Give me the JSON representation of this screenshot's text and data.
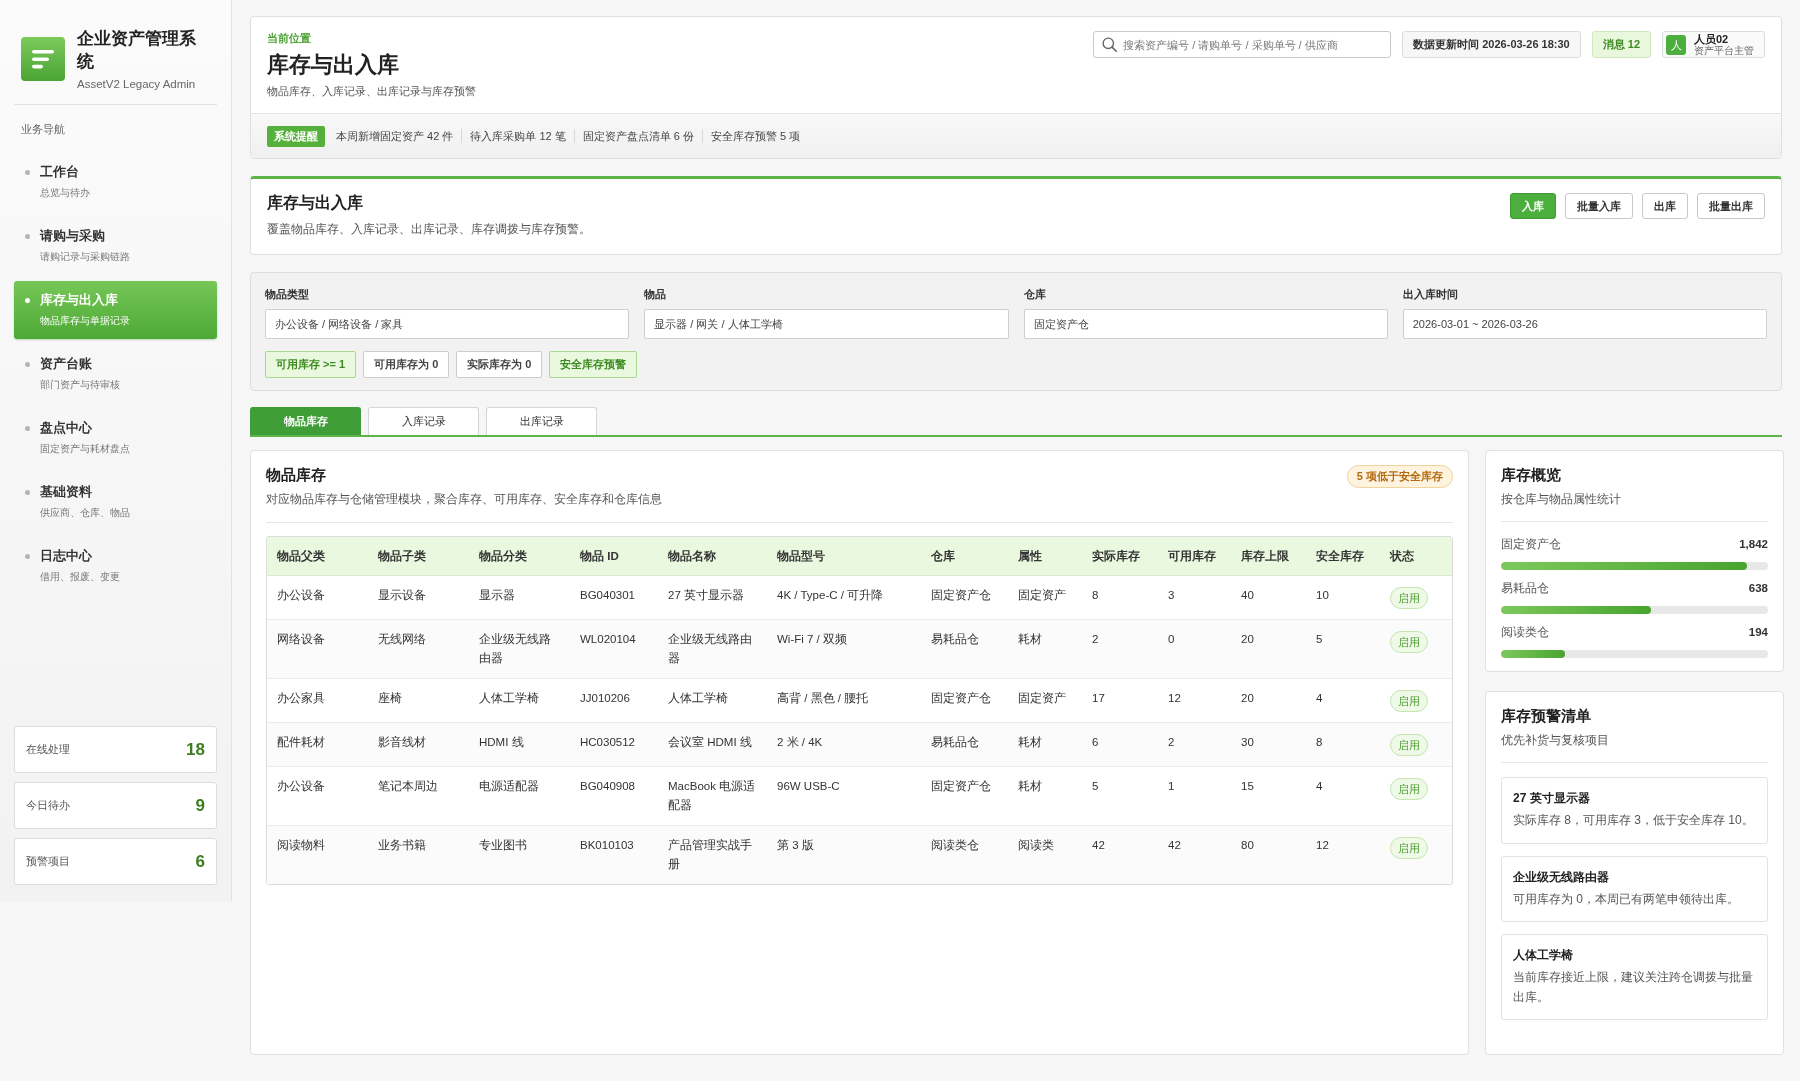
{
  "sidebar": {
    "app_title": "企业资产管理系统",
    "app_subtitle": "AssetV2 Legacy Admin",
    "section_label": "业务导航",
    "items": [
      {
        "title": "工作台",
        "subtitle": "总览与待办",
        "selected": false
      },
      {
        "title": "请购与采购",
        "subtitle": "请购记录与采购链路",
        "selected": false
      },
      {
        "title": "库存与出入库",
        "subtitle": "物品库存与单据记录",
        "selected": true
      },
      {
        "title": "资产台账",
        "subtitle": "部门资产与待审核",
        "selected": false
      },
      {
        "title": "盘点中心",
        "subtitle": "固定资产与耗材盘点",
        "selected": false
      },
      {
        "title": "基础资料",
        "subtitle": "供应商、仓库、物品",
        "selected": false
      },
      {
        "title": "日志中心",
        "subtitle": "借用、报废、变更",
        "selected": false
      }
    ],
    "stats": [
      {
        "label": "在线处理",
        "value": "18"
      },
      {
        "label": "今日待办",
        "value": "9"
      },
      {
        "label": "预警项目",
        "value": "6"
      }
    ]
  },
  "header": {
    "breadcrumb": "当前位置",
    "title": "库存与出入库",
    "subtitle": "物品库存、入库记录、出库记录与库存预警",
    "search": {
      "placeholder": "搜索资产编号 / 请购单号 / 采购单号 / 供应商"
    },
    "updated": "数据更新时间 2026-03-26 18:30",
    "messages": "消息 12",
    "user": {
      "avatar": "人",
      "name": "人员02",
      "role": "资产平台主管"
    }
  },
  "notice_bar": {
    "tag": "系统提醒",
    "items": [
      "本周新增固定资产 42 件",
      "待入库采购单 12 笔",
      "固定资产盘点清单 6 份",
      "安全库存预警 5 项"
    ]
  },
  "section": {
    "title": "库存与出入库",
    "subtitle": "覆盖物品库存、入库记录、出库记录、库存调拨与库存预警。",
    "buttons": [
      {
        "label": "入库",
        "kind": "primary"
      },
      {
        "label": "批量入库",
        "kind": "secondary"
      },
      {
        "label": "出库",
        "kind": "secondary"
      },
      {
        "label": "批量出库",
        "kind": "secondary"
      }
    ]
  },
  "filters": {
    "fields": [
      {
        "label": "物品类型",
        "value": "办公设备 / 网络设备 / 家具"
      },
      {
        "label": "物品",
        "value": "显示器 / 网关 / 人体工学椅"
      },
      {
        "label": "仓库",
        "value": "固定资产仓"
      },
      {
        "label": "出入库时间",
        "value": "2026-03-01 ~ 2026-03-26"
      }
    ],
    "chips": [
      {
        "label": "可用库存 >= 1",
        "selected": true
      },
      {
        "label": "可用库存为 0",
        "selected": false
      },
      {
        "label": "实际库存为 0",
        "selected": false
      },
      {
        "label": "安全库存预警",
        "selected": true
      }
    ]
  },
  "tabs": [
    {
      "label": "物品库存",
      "selected": true
    },
    {
      "label": "入库记录",
      "selected": false
    },
    {
      "label": "出库记录",
      "selected": false
    }
  ],
  "inventory": {
    "title": "物品库存",
    "subtitle": "对应物品库存与仓储管理模块，聚合库存、可用库存、安全库存和仓库信息",
    "badge": "5 项低于安全库存",
    "table": {
      "columns": [
        "物品父类",
        "物品子类",
        "物品分类",
        "物品 ID",
        "物品名称",
        "物品型号",
        "仓库",
        "属性",
        "实际库存",
        "可用库存",
        "库存上限",
        "安全库存",
        "状态"
      ],
      "rows": [
        {
          "cells": [
            "办公设备",
            "显示设备",
            "显示器",
            "BG040301",
            "27 英寸显示器",
            "4K / Type-C / 可升降",
            "固定资产仓",
            "固定资产",
            "8",
            "3",
            "40",
            "10"
          ],
          "status": "启用"
        },
        {
          "cells": [
            "网络设备",
            "无线网络",
            "企业级无线路由器",
            "WL020104",
            "企业级无线路由器",
            "Wi-Fi 7 / 双频",
            "易耗品仓",
            "耗材",
            "2",
            "0",
            "20",
            "5"
          ],
          "status": "启用"
        },
        {
          "cells": [
            "办公家具",
            "座椅",
            "人体工学椅",
            "JJ010206",
            "人体工学椅",
            "高背 / 黑色 / 腰托",
            "固定资产仓",
            "固定资产",
            "17",
            "12",
            "20",
            "4"
          ],
          "status": "启用"
        },
        {
          "cells": [
            "配件耗材",
            "影音线材",
            "HDMI 线",
            "HC030512",
            "会议室 HDMI 线",
            "2 米 / 4K",
            "易耗品仓",
            "耗材",
            "6",
            "2",
            "30",
            "8"
          ],
          "status": "启用"
        },
        {
          "cells": [
            "办公设备",
            "笔记本周边",
            "电源适配器",
            "BG040908",
            "MacBook 电源适配器",
            "96W USB-C",
            "固定资产仓",
            "耗材",
            "5",
            "1",
            "15",
            "4"
          ],
          "status": "启用"
        },
        {
          "cells": [
            "阅读物料",
            "业务书籍",
            "专业图书",
            "BK010103",
            "产品管理实战手册",
            "第 3 版",
            "阅读类仓",
            "阅读类",
            "42",
            "42",
            "80",
            "12"
          ],
          "status": "启用"
        }
      ]
    }
  },
  "overview": {
    "title": "库存概览",
    "subtitle": "按仓库与物品属性统计",
    "bars": [
      {
        "label": "固定资产仓",
        "value": "1,842",
        "level": 0.92
      },
      {
        "label": "易耗品仓",
        "value": "638",
        "level": 0.56
      },
      {
        "label": "阅读类仓",
        "value": "194",
        "level": 0.24
      }
    ]
  },
  "alerts": {
    "title": "库存预警清单",
    "subtitle": "优先补货与复核项目",
    "items": [
      {
        "title": "27 英寸显示器",
        "text": "实际库存 8，可用库存 3，低于安全库存 10。"
      },
      {
        "title": "企业级无线路由器",
        "text": "可用库存为 0，本周已有两笔申领待出库。"
      },
      {
        "title": "人体工学椅",
        "text": "当前库存接近上限，建议关注跨仓调拨与批量出库。"
      }
    ]
  }
}
